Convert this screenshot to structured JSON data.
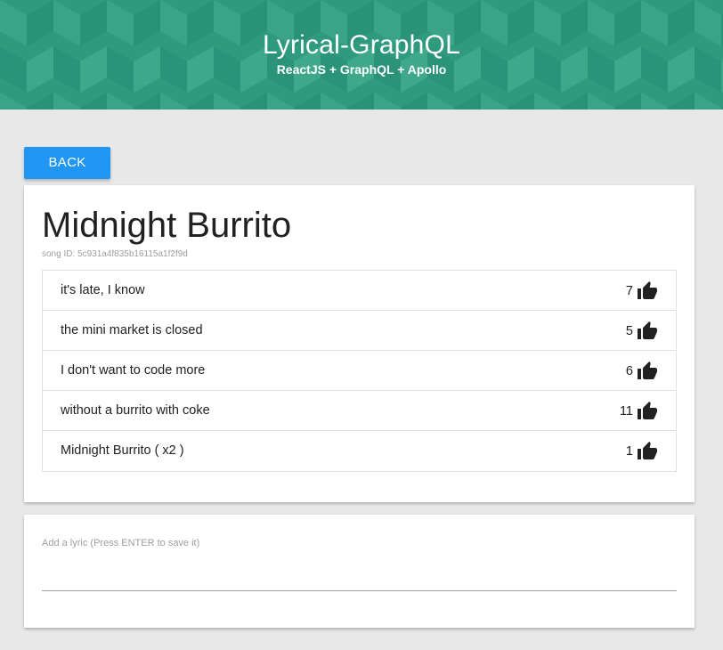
{
  "header": {
    "title": "Lyrical-GraphQL",
    "subtitle": "ReactJS + GraphQL + Apollo"
  },
  "back_button": {
    "label": "BACK"
  },
  "song": {
    "title": "Midnight Burrito",
    "id_label": "song ID: 5c931a4f835b16115a1f2f9d"
  },
  "lyrics": [
    {
      "text": "it's late, I know",
      "likes": "7"
    },
    {
      "text": "the mini market is closed",
      "likes": "5"
    },
    {
      "text": "I don't want to code more",
      "likes": "6"
    },
    {
      "text": "without a burrito with coke",
      "likes": "11"
    },
    {
      "text": "Midnight Burrito ( x2 )",
      "likes": "1"
    }
  ],
  "add_lyric": {
    "label": "Add a lyric (Press ENTER to save it)",
    "value": ""
  },
  "icons": {
    "like": "thumb-up-icon"
  },
  "colors": {
    "banner": "#2f9a7e",
    "button": "#2196f3",
    "background": "#e8e8e8"
  }
}
